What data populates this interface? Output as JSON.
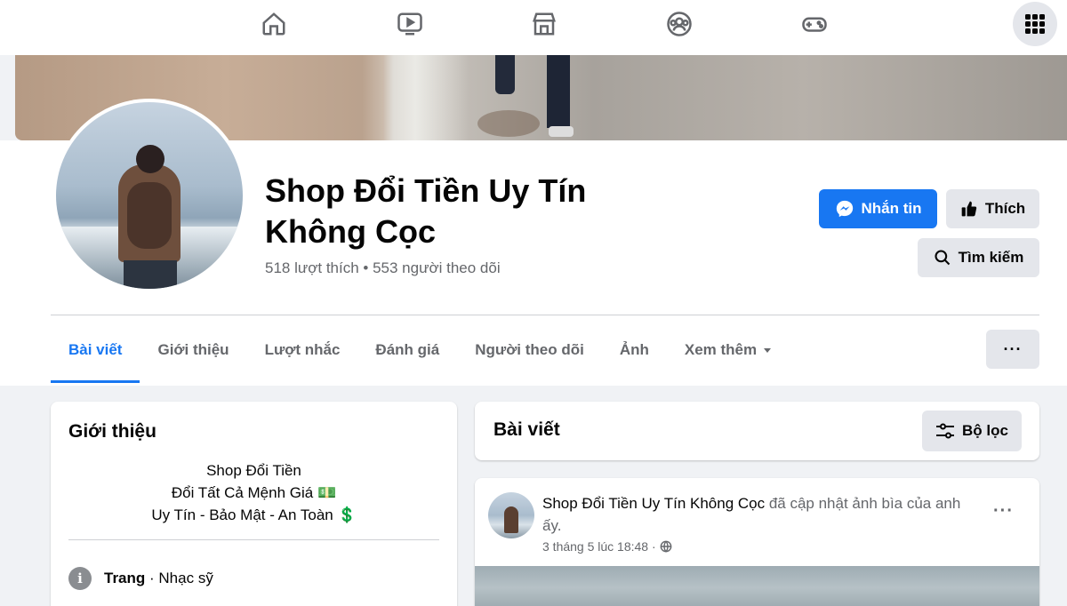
{
  "top_nav": {
    "icons": [
      "home-icon",
      "video-icon",
      "marketplace-icon",
      "groups-icon",
      "gaming-icon"
    ],
    "menu_icon": "grid-menu-icon"
  },
  "profile": {
    "name": "Shop Đổi Tiền Uy Tín Không Cọc",
    "stats": "518 lượt thích • 553 người theo dõi",
    "buttons": {
      "message": "Nhắn tin",
      "like": "Thích",
      "search": "Tìm kiếm"
    }
  },
  "tabs": [
    {
      "label": "Bài viết",
      "active": true
    },
    {
      "label": "Giới thiệu"
    },
    {
      "label": "Lượt nhắc"
    },
    {
      "label": "Đánh giá"
    },
    {
      "label": "Người theo dõi"
    },
    {
      "label": "Ảnh"
    },
    {
      "label": "Xem thêm"
    }
  ],
  "more_button": "···",
  "intro": {
    "title": "Giới thiệu",
    "lines": [
      "Shop Đổi Tiền",
      "Đổi Tất Cả Mệnh Giá 💵",
      "Uy Tín - Bảo Mật - An Toàn 💲"
    ],
    "info": {
      "label": "Trang",
      "value": " · Nhạc sỹ"
    }
  },
  "posts": {
    "title": "Bài viết",
    "filter_label": "Bộ lọc"
  },
  "post": {
    "author": "Shop Đổi Tiền Uy Tín Không Cọc",
    "action": " đã cập nhật ảnh bìa của anh ấy.",
    "time": "3 tháng 5 lúc 18:48 ·",
    "privacy_icon": "globe-icon"
  },
  "colors": {
    "accent": "#1877f2",
    "background": "#f0f2f5",
    "secondary_button": "#e4e6eb"
  }
}
